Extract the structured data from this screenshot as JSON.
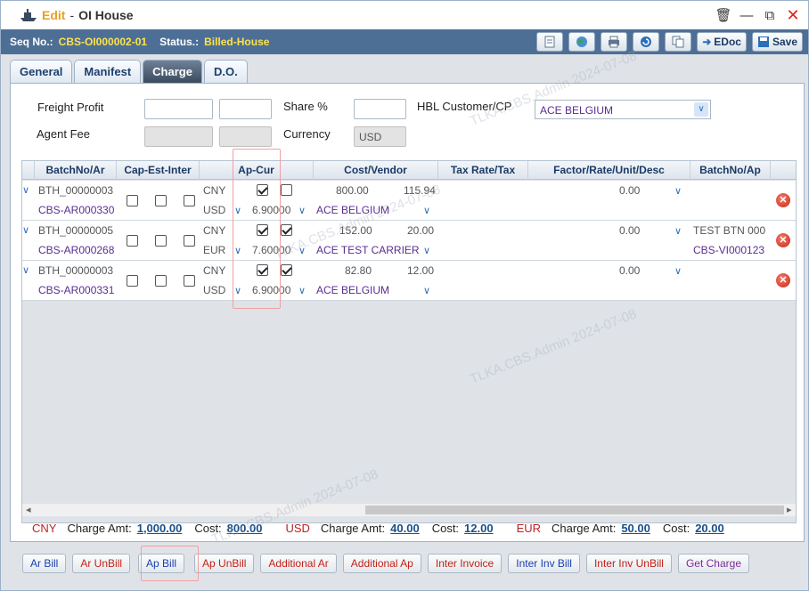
{
  "window": {
    "edit_label": "Edit",
    "title": "OI House"
  },
  "header": {
    "seq_label": "Seq No.:",
    "seq_value": "CBS-OI000002-01",
    "status_label": "Status.:",
    "status_value": "Billed-House",
    "edoc_label": "EDoc",
    "save_label": "Save"
  },
  "tabs": [
    "General",
    "Manifest",
    "Charge",
    "D.O."
  ],
  "active_tab": "Charge",
  "form": {
    "freight_profit_label": "Freight Profit",
    "share_label": "Share %",
    "hbl_customer_label": "HBL Customer/CP",
    "hbl_customer_value": "ACE BELGIUM",
    "agent_fee_label": "Agent Fee",
    "currency_label": "Currency",
    "currency_value": "USD"
  },
  "grid": {
    "headers": [
      "BatchNo/Ar",
      "Cap-Est-Inter",
      "Ap-Cur",
      "Cost/Vendor",
      "Tax Rate/Tax",
      "Factor/Rate/Unit/Desc",
      "BatchNo/Ap"
    ],
    "rows": [
      {
        "batch_ar": "BTH_00000003",
        "ar_no": "CBS-AR000330",
        "cur1": "CNY",
        "cur2": "USD",
        "rate": "6.90000",
        "cost": "800.00",
        "tax": "115.94",
        "vendor": "ACE BELGIUM",
        "factor": "0.00",
        "batch_ap": "",
        "ap_no": "",
        "ap_checked": true,
        "ap_cur_checked": false
      },
      {
        "batch_ar": "BTH_00000005",
        "ar_no": "CBS-AR000268",
        "cur1": "CNY",
        "cur2": "EUR",
        "rate": "7.60000",
        "cost": "152.00",
        "tax": "20.00",
        "vendor": "ACE TEST CARRIER",
        "factor": "0.00",
        "batch_ap": "TEST BTN 000",
        "ap_no": "CBS-VI000123",
        "ap_checked": true,
        "ap_cur_checked": true
      },
      {
        "batch_ar": "BTH_00000003",
        "ar_no": "CBS-AR000331",
        "cur1": "CNY",
        "cur2": "USD",
        "rate": "6.90000",
        "cost": "82.80",
        "tax": "12.00",
        "vendor": "ACE BELGIUM",
        "factor": "0.00",
        "batch_ap": "",
        "ap_no": "",
        "ap_checked": true,
        "ap_cur_checked": true
      }
    ]
  },
  "totals": [
    {
      "currency": "CNY",
      "charge_label": "Charge Amt:",
      "charge": "1,000.00",
      "cost_label": "Cost:",
      "cost": "800.00"
    },
    {
      "currency": "USD",
      "charge_label": "Charge Amt:",
      "charge": "40.00",
      "cost_label": "Cost:",
      "cost": "12.00"
    },
    {
      "currency": "EUR",
      "charge_label": "Charge Amt:",
      "charge": "50.00",
      "cost_label": "Cost:",
      "cost": "20.00"
    }
  ],
  "buttons": [
    "Ar Bill",
    "Ar UnBill",
    "Ap Bill",
    "Ap UnBill",
    "Additional Ar",
    "Additional Ap",
    "Inter Invoice",
    "Inter Inv Bill",
    "Inter Inv UnBill",
    "Get Charge"
  ],
  "watermark": "TLKA.CBS.Admin 2024-07-08",
  "colors": {
    "header_bar": "#4d6f96",
    "accent_yellow": "#ffe24a",
    "vendor_purple": "#5a2d92",
    "delete_red": "#c82a1a"
  }
}
